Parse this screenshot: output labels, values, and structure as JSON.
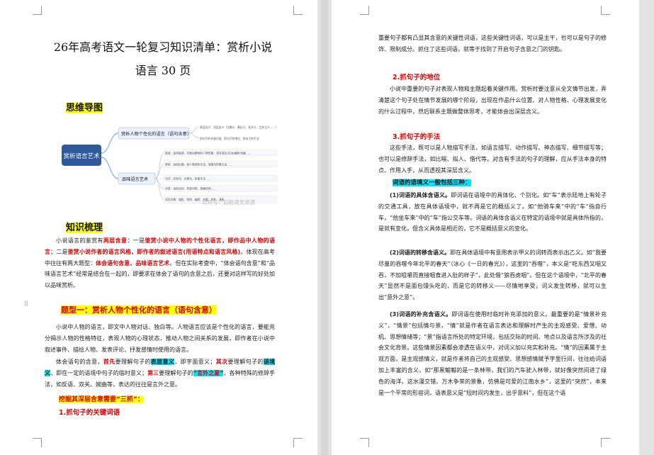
{
  "page1": {
    "title_line1": "26年高考语文一轮复习知识清单：赏析小说",
    "title_line2": "语言 30 页",
    "mindmap_heading": "思维导图",
    "mindmap": {
      "root": "赏析语言艺术",
      "branch1": "赏析人物个性化的语言（语句含意）",
      "branch1_items": [
        "表层含义：深层含义（比喻义、象征义、双关义、言外之义……）",
        "抓句子的关键词语、抓句子的地位、抓句子的手法"
      ],
      "branch2": "品味语言艺术",
      "branch2_items": [
        "叙述：运用叙述，勾勒出鲜明的人物形象；语言简洁/生动/幽默/含蓄……",
        "修辞：运用比喻、拟人等修辞手法，使描写形象生动……",
        "句式：长短句、对偶句、反复手法……",
        "词语：运用动词、形容词等，准确传神……",
        "语言风格：通俗、明快、幽默、含蓄、质朴、清新……"
      ],
      "watermark": "公众号：启航语文资源"
    },
    "knowledge_heading": "知识梳理",
    "intro": {
      "t1": "小说语言的鉴赏有",
      "t2": "两层含意",
      "t3": "：一是",
      "t4": "鉴赏小说中人物的个性化语言，即作品中人物的语言",
      "t5": "；二是",
      "t6": "鉴赏小说作者的语言风格，即作者的叙述语言(用语特点和语言风格)",
      "t7": "。体现在高考中往往有两大题型：",
      "t8": "体会语句含意、品味语言艺术",
      "t9": "。但在实际考查中，“体会语句含意”和“品味语言艺术”经常是结合在一起的，即要求在体会了语句的含意之后，还要对这样写的好处加以品味赏析。"
    },
    "type1_label": "题型一：",
    "type1_title": "赏析人物个性化的语言（语句含意）",
    "para2": "小说中人物的语言，即文中人物对话、独白等。人物语言应该是个性化的语言，要能充分揭示人物的性格特征，表现人物的心理状态，推动人物之间关系的发展，即作者在小说中叙述事件、描绘人物、发表评论、抒发感情时使用的语言。",
    "para3": {
      "t1": "体会语句的含意，",
      "t2": "首先",
      "t3": "要理解句子的",
      "t4": "表层意义",
      "t5": "，即字面意义；",
      "t6": "其次",
      "t7": "要理解句子的",
      "t8": "语境义",
      "t9": "，即在一定的语境中句子的临时意义；",
      "t10": "第三",
      "t11": "要理解句子的",
      "t12": "“言外之意”",
      "t13": "，各种特殊的修辞手法，如反语、双关、婉曲等，表达的往往是言外之意。"
    },
    "grasp_line": "挖掘其深层含意需要“三抓”：",
    "sec1": "1.抓句子的关键词语"
  },
  "page2": {
    "para_top": "重要句子都有凸显其含意的关键性词语，这些关键性词语，可以是主干，也可以是句子的修饰、限制成分。抓住了这些词语，就等于找到了开启句子含意之门的钥匙。",
    "sec2": "2.抓句子的地位",
    "para_pos": "小说中重要的句子对表现人物和主题起着关键作用。赏析时要注意从全文情节出发，弄清楚这个句子处在情节发展的哪个阶段，出现在作品什么位置、对人物性格、心理发展变化的什么过程中，然后联系主题做整体思考，才能体会出深层含义。",
    "sec3": "3.抓句子的手法",
    "para_tech": "这些手法，既可以是人物描写手法，如语言描写、动作描写、神态描写、细节描写等；也可以是修辞手法，如比喻、拟人、借代等。对含有手法的句子的理解，应从手法本身的特点、作用入手，从而透视其深层含义。",
    "meaning_heading": "词语的语境义一般包括三种：",
    "m1": {
      "label": "(1)词语的具体含语义。",
      "text": "即词语在语境中的具体化、个别化。如“车”表示陆地上有轮子的交通工具，放在具体语境中，就不再是它的概括义了。如“他骑车来”中的“车”指自行车，“他坐车来”中的“车”指公交车等。词语的具体含语义在特定的语境中就是具体所指的，是就有变化，但含义具体是相近的，它不是概括意义的变化。"
    },
    "m2": {
      "label": "(2)词语的转移含语义。",
      "text": "即在具体语境中有意用表示甲义的词转而表示出乙义。如“我要尽量的吞噬今年北平的春天”（冰心《一日的春光》），这里的“吞噬”，本义是“吃东西又咽又吞，不加咀嚼而直接咽食进入肚的样子”，此处借“狼吞虎咽”。但在这个语境中，“北平的春天”显然不是面包馒头吃的，而是它的转移义——尽情地享受，词义发生转移，就可以生出“意外之意”。"
    },
    "m3": {
      "label": "(3)词语的补充含语义。",
      "text": "即词语在使用时临时补充添加的意义。最重要的是“情景补充义”，“情景”包括情与景，“情”就是作者在语言表达和理解时产生的主观感受、爱憎、动机、思想情绪等；“景”指语言所处的特定环境，包括交际的时间、地点以及语言所涉及的社会文化背景。这些情景因素都会渗透在语义中，对词义加以充实和补充。“情”的因素属于主观方面，是主观感情义，就是作者将自己的主观感受、思想感情赋予字里行间，往往给词语加上丰富的含义，如“那黑魆魆的是一条林带，我们的汽车驶入林带，就好像突然间进了绿色的海洋。这水漫交错、万木争荣的景象，仿佛是可爱的江南水乡”，这里的“突然”，本来是一个平常的形容词，语表意义是“短时间内发生，出乎意料”，但在这个语"
    }
  }
}
